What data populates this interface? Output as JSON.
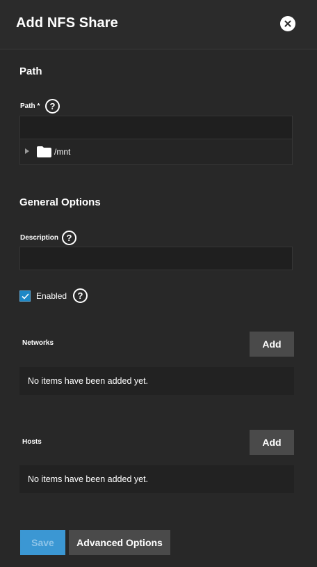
{
  "dialog": {
    "title": "Add NFS Share",
    "close_icon": "close-icon"
  },
  "path_section": {
    "title": "Path",
    "field_label": "Path *",
    "input_value": "",
    "tree": {
      "expanded": false,
      "folder_label": "/mnt"
    }
  },
  "general_section": {
    "title": "General Options",
    "description_label": "Description",
    "description_value": "",
    "enabled_label": "Enabled",
    "enabled_checked": true
  },
  "networks": {
    "label": "Networks",
    "add_label": "Add",
    "empty_text": "No items have been added yet."
  },
  "hosts": {
    "label": "Hosts",
    "add_label": "Add",
    "empty_text": "No items have been added yet."
  },
  "actions": {
    "save_label": "Save",
    "save_disabled": true,
    "advanced_label": "Advanced Options"
  },
  "colors": {
    "background": "#282828",
    "accent": "#3b97d3",
    "button": "#4a4a4a"
  }
}
